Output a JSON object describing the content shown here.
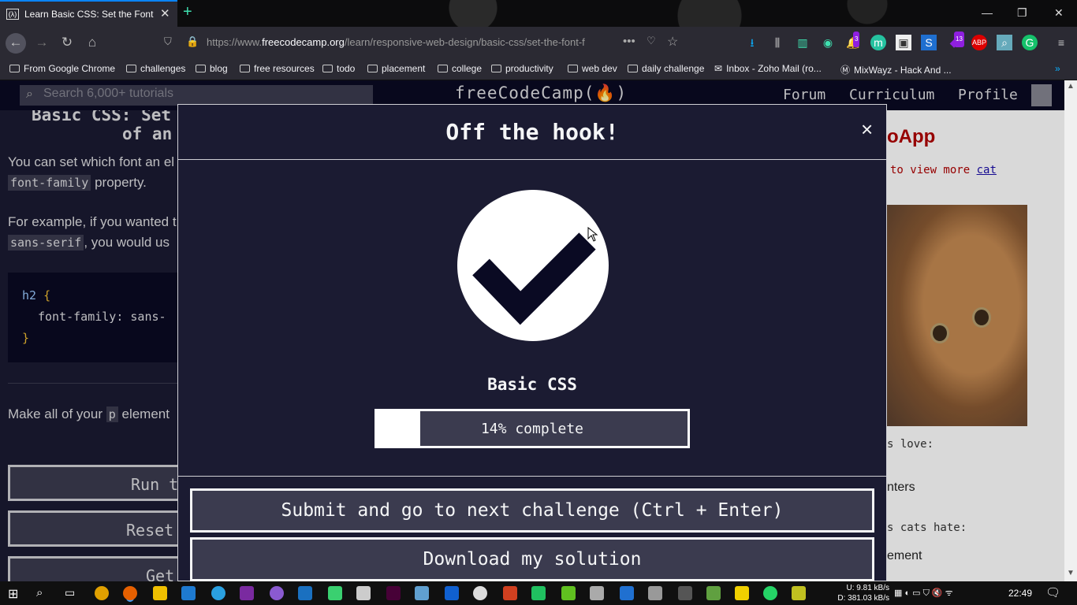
{
  "browser": {
    "tab_title": "Learn Basic CSS: Set the Font Fa",
    "tab_favicon": "(λ)",
    "url_prefix": "https://www.",
    "url_domain": "freecodecamp.org",
    "url_path": "/learn/responsive-web-design/basic-css/set-the-font-f",
    "badges": {
      "notifications": "3",
      "extensions": "13"
    },
    "bookmarks": [
      "From Google Chrome",
      "challenges",
      "blog",
      "free resources",
      "todo",
      "placement",
      "college",
      "productivity",
      "web dev",
      "daily challenge",
      "Inbox - Zoho Mail (ro...",
      "MixWayz - Hack And ..."
    ],
    "bookmark_icon_inbox": "mail-icon",
    "bookmark_icon_mixwayz": "m-logo-icon"
  },
  "fcc_nav": {
    "search_placeholder": "Search 6,000+ tutorials",
    "logo": "freeCodeCamp(🔥)",
    "links": [
      "Forum",
      "Curriculum",
      "Profile"
    ]
  },
  "lesson": {
    "title_line1": "Basic CSS: Set",
    "title_line2": "of an",
    "para1_a": "You can set which font an el",
    "para1_code": "font-family",
    "para1_b": "property.",
    "para2_a": "For example, if you wanted t",
    "para2_code": "sans-serif",
    "para2_b": ", you would us",
    "code_l1_sel": "h2",
    "code_l1_brace": "{",
    "code_l2": "font-family: sans-",
    "code_l3": "}",
    "task_a": "Make all of your",
    "task_code": "p",
    "task_b": "element",
    "btn_run": "Run t",
    "btn_reset": "Reset",
    "btn_get": "Get"
  },
  "preview": {
    "title_frag": "oApp",
    "line_a": "to view more",
    "line_link": "cat",
    "list1": "s love:",
    "item1": "nters",
    "list2": "s cats hate:",
    "item2": "ement"
  },
  "modal": {
    "title": "Off the hook!",
    "close": "×",
    "cert": "Basic CSS",
    "progress_percent": 14,
    "progress_label": "14% complete",
    "submit_label": "Submit and go to next challenge (Ctrl + Enter)",
    "download_label": "Download my solution"
  },
  "taskbar": {
    "net_up": "U:  9.81 kB/s",
    "net_down": "D: 381.03 kB/s",
    "time": "22:49"
  },
  "colors": {
    "accent": "#0a84ff",
    "fcc_dark": "#0a0a23",
    "fcc_bg": "#1b1b32",
    "fcc_gray": "#3b3b4f",
    "preview_red": "#b10000"
  }
}
